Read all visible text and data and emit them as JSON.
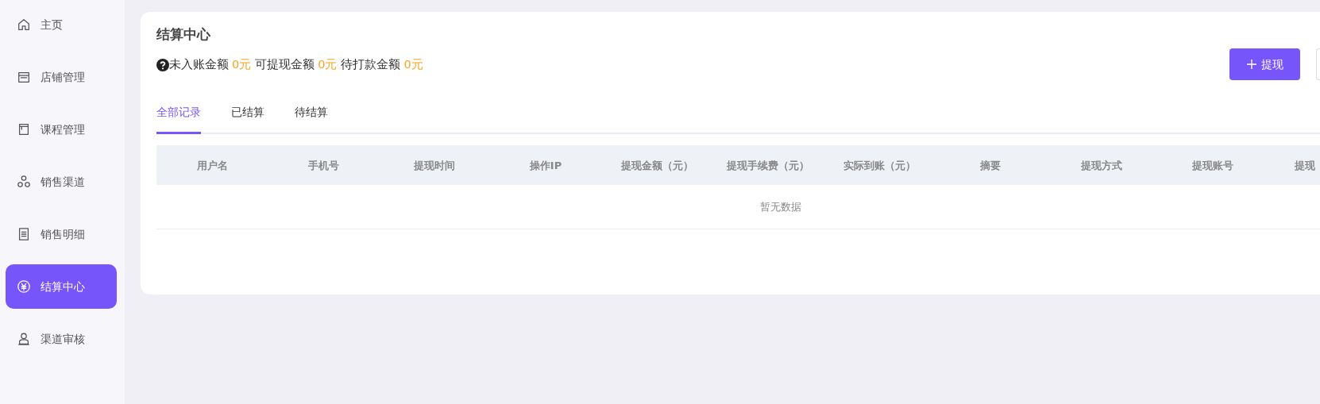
{
  "sidebar": {
    "items": [
      {
        "label": "主页",
        "selected": false
      },
      {
        "label": "店铺管理",
        "selected": false
      },
      {
        "label": "课程管理",
        "selected": false
      },
      {
        "label": "销售渠道",
        "selected": false
      },
      {
        "label": "销售明细",
        "selected": false
      },
      {
        "label": "结算中心",
        "selected": true
      },
      {
        "label": "渠道审核",
        "selected": false
      }
    ]
  },
  "page": {
    "title": "结算中心",
    "summary": [
      {
        "label": "未入账金额",
        "amount": "0元"
      },
      {
        "label": "可提现金额",
        "amount": "0元"
      },
      {
        "label": "待打款金额",
        "amount": "0元"
      }
    ],
    "withdraw_button": {
      "label": "提现"
    },
    "tabs": [
      {
        "label": "全部记录",
        "selected": true
      },
      {
        "label": "已结算",
        "selected": false
      },
      {
        "label": "待结算",
        "selected": false
      }
    ],
    "table": {
      "columns": [
        "用户名",
        "手机号",
        "提现时间",
        "操作IP",
        "提现金额（元）",
        "提现手续费（元）",
        "实际到账（元）",
        "摘要",
        "提现方式",
        "提现账号",
        "提现"
      ],
      "empty_text": "暂无数据"
    }
  }
}
